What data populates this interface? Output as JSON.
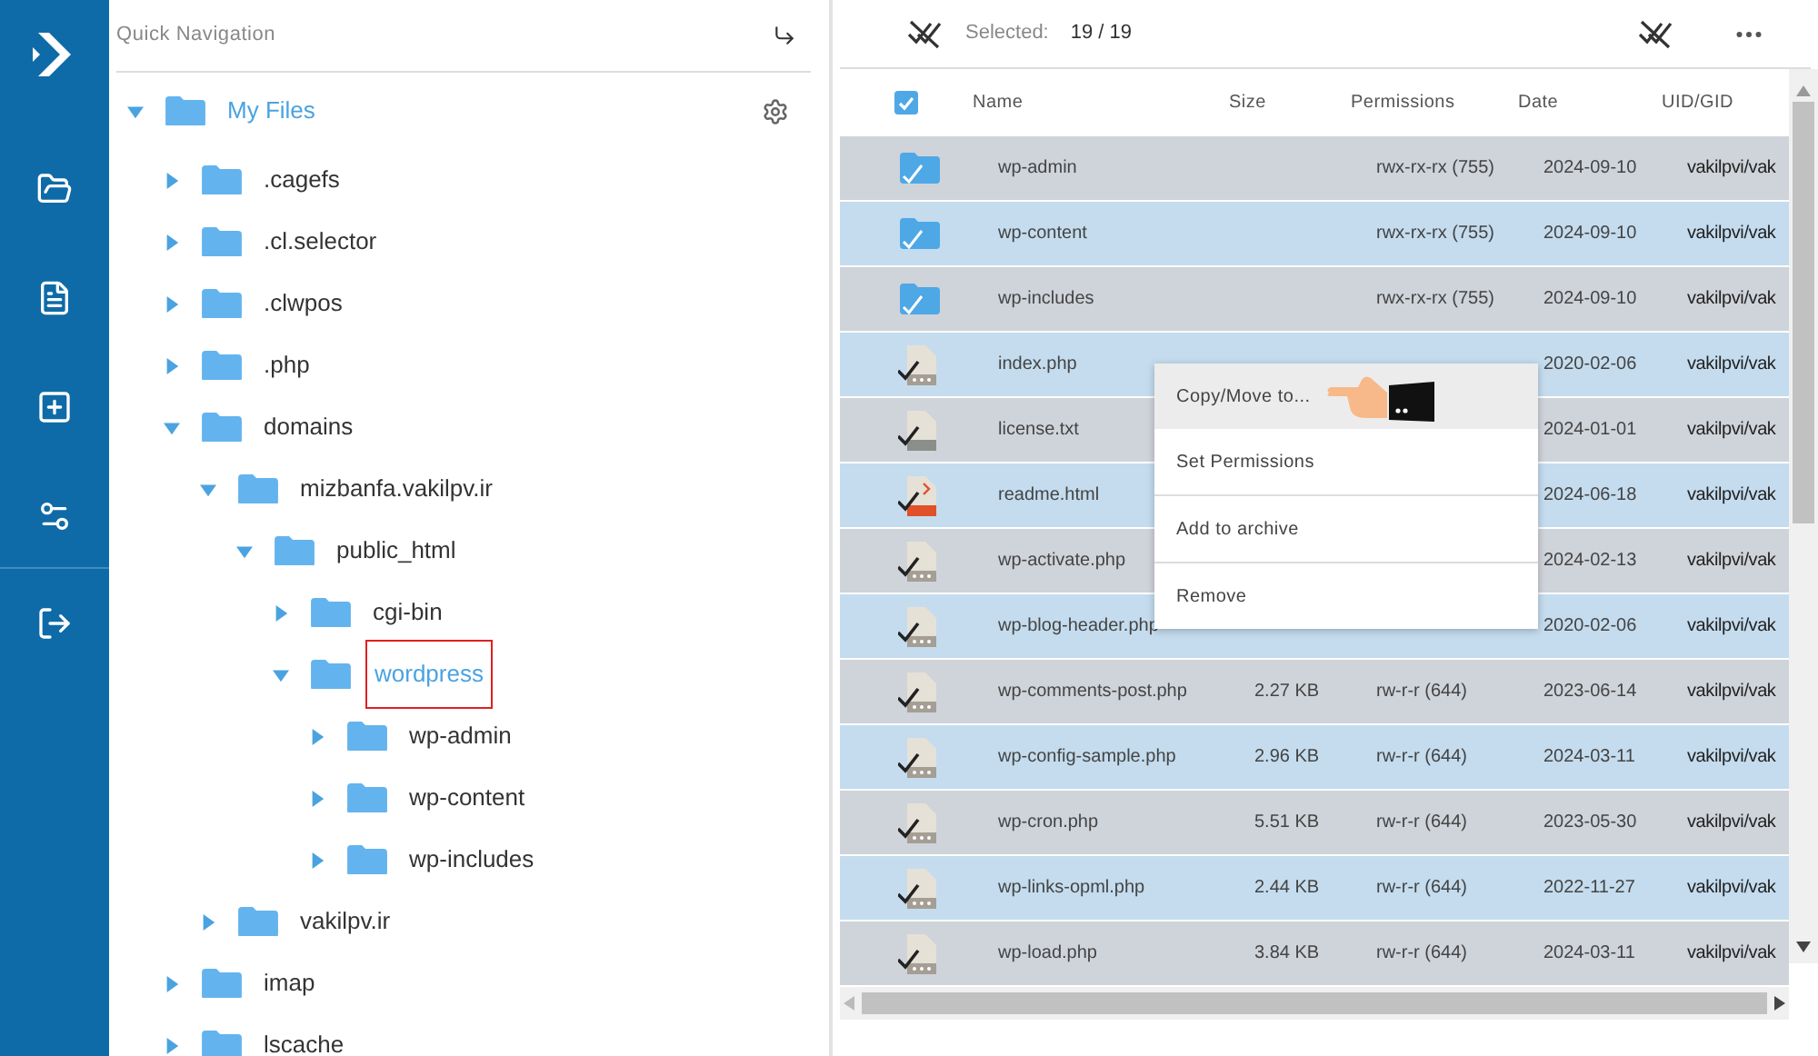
{
  "quick_navigation": {
    "title": "Quick Navigation"
  },
  "tree": {
    "root": {
      "name": "My Files",
      "expanded": true
    },
    "items": [
      {
        "name": ".cagefs",
        "expanded": false,
        "selected": false,
        "highlighted": false
      },
      {
        "name": ".cl.selector",
        "expanded": false,
        "selected": false,
        "highlighted": false
      },
      {
        "name": ".clwpos",
        "expanded": false,
        "selected": false,
        "highlighted": false
      },
      {
        "name": ".php",
        "expanded": false,
        "selected": false,
        "highlighted": false
      },
      {
        "name": "domains",
        "expanded": true,
        "selected": false,
        "highlighted": false,
        "children": [
          {
            "name": "mizbanfa.vakilpv.ir",
            "expanded": true,
            "selected": false,
            "highlighted": false,
            "children": [
              {
                "name": "public_html",
                "expanded": true,
                "selected": false,
                "highlighted": false,
                "children": [
                  {
                    "name": "cgi-bin",
                    "expanded": false,
                    "selected": false,
                    "highlighted": false
                  },
                  {
                    "name": "wordpress",
                    "expanded": true,
                    "selected": true,
                    "highlighted": true,
                    "children": [
                      {
                        "name": "wp-admin",
                        "expanded": false,
                        "selected": false,
                        "highlighted": false
                      },
                      {
                        "name": "wp-content",
                        "expanded": false,
                        "selected": false,
                        "highlighted": false
                      },
                      {
                        "name": "wp-includes",
                        "expanded": false,
                        "selected": false,
                        "highlighted": false
                      }
                    ]
                  }
                ]
              }
            ]
          },
          {
            "name": "vakilpv.ir",
            "expanded": false,
            "selected": false,
            "highlighted": false
          }
        ]
      },
      {
        "name": "imap",
        "expanded": false,
        "selected": false,
        "highlighted": false
      },
      {
        "name": "lscache",
        "expanded": false,
        "selected": false,
        "highlighted": false
      }
    ]
  },
  "toolbar": {
    "selected_label": "Selected:",
    "selected_count": "19 / 19"
  },
  "table": {
    "select_all": true,
    "columns": [
      "Name",
      "Size",
      "Permissions",
      "Date",
      "UID/GID"
    ],
    "rows": [
      {
        "kind": "folder",
        "selected": true,
        "name": "wp-admin",
        "permissions": "rwx-rx-rx (755)",
        "date": "2024-09-10",
        "uid": "vakilpvi/vak"
      },
      {
        "kind": "folder",
        "selected": true,
        "name": "wp-content",
        "permissions": "rwx-rx-rx (755)",
        "date": "2024-09-10",
        "uid": "vakilpvi/vak"
      },
      {
        "kind": "folder",
        "selected": true,
        "name": "wp-includes",
        "permissions": "rwx-rx-rx (755)",
        "date": "2024-09-10",
        "uid": "vakilpvi/vak"
      },
      {
        "kind": "php",
        "selected": true,
        "name": "index.php",
        "date": "2020-02-06",
        "uid": "vakilpvi/vak"
      },
      {
        "kind": "txt",
        "selected": true,
        "name": "license.txt",
        "date": "2024-01-01",
        "uid": "vakilpvi/vak"
      },
      {
        "kind": "html",
        "selected": true,
        "name": "readme.html",
        "date": "2024-06-18",
        "uid": "vakilpvi/vak"
      },
      {
        "kind": "php",
        "selected": true,
        "name": "wp-activate.php",
        "date": "2024-02-13",
        "uid": "vakilpvi/vak"
      },
      {
        "kind": "php",
        "selected": true,
        "name": "wp-blog-header.php",
        "date": "2020-02-06",
        "uid": "vakilpvi/vak"
      },
      {
        "kind": "php",
        "selected": true,
        "name": "wp-comments-post.php",
        "size": "2.27 KB",
        "permissions": "rw-r-r (644)",
        "date": "2023-06-14",
        "uid": "vakilpvi/vak"
      },
      {
        "kind": "php",
        "selected": true,
        "name": "wp-config-sample.php",
        "size": "2.96 KB",
        "permissions": "rw-r-r (644)",
        "date": "2024-03-11",
        "uid": "vakilpvi/vak"
      },
      {
        "kind": "php",
        "selected": true,
        "name": "wp-cron.php",
        "size": "5.51 KB",
        "permissions": "rw-r-r (644)",
        "date": "2023-05-30",
        "uid": "vakilpvi/vak"
      },
      {
        "kind": "php",
        "selected": true,
        "name": "wp-links-opml.php",
        "size": "2.44 KB",
        "permissions": "rw-r-r (644)",
        "date": "2022-11-27",
        "uid": "vakilpvi/vak"
      },
      {
        "kind": "php",
        "selected": true,
        "name": "wp-load.php",
        "size": "3.84 KB",
        "permissions": "rw-r-r (644)",
        "date": "2024-03-11",
        "uid": "vakilpvi/vak"
      }
    ]
  },
  "context_menu": {
    "items": [
      {
        "label": "Copy/Move to...",
        "selected": true,
        "pointer": true
      },
      {
        "label": "Set Permissions",
        "selected": false,
        "pointer": false
      },
      {
        "label": "Add to archive",
        "selected": false,
        "pointer": false
      },
      {
        "label": "Remove",
        "selected": false,
        "pointer": false
      }
    ]
  }
}
